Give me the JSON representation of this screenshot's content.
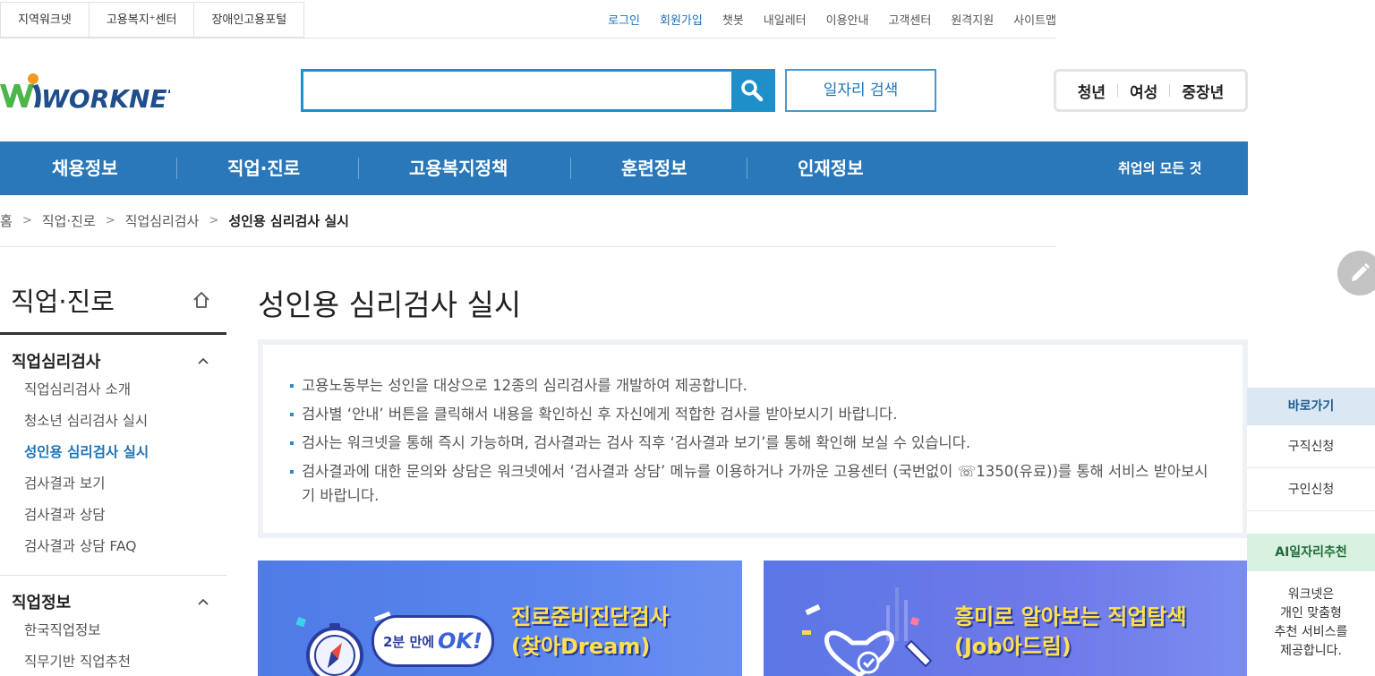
{
  "util": {
    "left": [
      "지역워크넷",
      "고용복지⁺센터",
      "장애인고용포털"
    ],
    "right": [
      "로그인",
      "회원가입",
      "챗봇",
      "내일레터",
      "이용안내",
      "고객센터",
      "원격지원",
      "사이트맵"
    ]
  },
  "header": {
    "logo_text": "WORKNET",
    "search_placeholder": "",
    "job_search_label": "일자리 검색",
    "targets": [
      "청년",
      "여성",
      "중장년"
    ]
  },
  "gnb": {
    "items": [
      "채용정보",
      "직업·진로",
      "고용복지정책",
      "훈련정보",
      "인재정보"
    ],
    "all": "취업의 모든 것"
  },
  "breadcrumb": [
    "홈",
    "직업·진로",
    "직업심리검사",
    "성인용 심리검사 실시"
  ],
  "lnb": {
    "title": "직업·진로",
    "sections": [
      {
        "title": "직업심리검사",
        "items": [
          "직업심리검사 소개",
          "청소년 심리검사 실시",
          "성인용 심리검사 실시",
          "검사결과 보기",
          "검사결과 상담",
          "검사결과 상담 FAQ"
        ]
      },
      {
        "title": "직업정보",
        "items": [
          "한국직업정보",
          "직무기반 직업추천"
        ]
      }
    ]
  },
  "content": {
    "title": "성인용 심리검사 실시",
    "notes": [
      "고용노동부는 성인을 대상으로 12종의 심리검사를 개발하여 제공합니다.",
      "검사별 ‘안내’ 버튼을 클릭해서 내용을 확인하신 후 자신에게 적합한 검사를 받아보시기 바랍니다.",
      "검사는 워크넷을 통해 즉시 가능하며, 검사결과는 검사 직후 ‘검사결과 보기’를 통해 확인해 보실 수 있습니다.",
      "검사결과에 대한 문의와 상담은 워크넷에서 ‘검사결과 상담’ 메뉴를 이용하거나 가까운 고용센터 (국번없이 ☏1350(유료))를 통해 서비스 받아보시기 바랍니다."
    ],
    "banners": [
      {
        "pill_small": "2분 만에",
        "pill_big": "OK!",
        "line1": "진로준비진단검사",
        "line2": "(찾아Dream)"
      },
      {
        "line1": "흥미로 알아보는 직업탐색",
        "line2": "(Job아드림)"
      }
    ]
  },
  "quick": {
    "title": "바로가기",
    "items": [
      "구직신청",
      "구인신청"
    ],
    "ai_title": "AI일자리추천",
    "ai_desc": [
      "워크넷은",
      "개인 맞춤형",
      "추천 서비스를",
      "제공합니다."
    ]
  },
  "colors": {
    "brand_blue": "#2a78b9",
    "search_blue": "#1e8fc9",
    "logo_green": "#4cb648",
    "logo_orange": "#f29a1e"
  }
}
